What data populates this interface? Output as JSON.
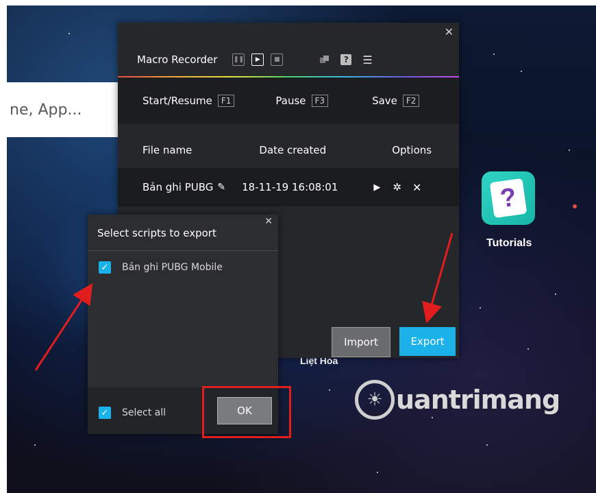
{
  "background": {
    "search_placeholder": "ne, App...",
    "desktop_label": "Liệt Hỏa",
    "tutorials_label": "Tutorials",
    "tutorials_icon": "question-mark-icon",
    "watermark": "uantrimang"
  },
  "macro_recorder": {
    "title": "Macro Recorder",
    "controls": [
      "pause-icon",
      "play-icon",
      "stop-icon"
    ],
    "tools": [
      "windows-icon",
      "help-icon",
      "list-icon"
    ],
    "hotkeys": [
      {
        "label": "Start/Resume",
        "key": "F1"
      },
      {
        "label": "Pause",
        "key": "F3"
      },
      {
        "label": "Save",
        "key": "F2"
      }
    ],
    "columns": {
      "file_name": "File name",
      "date_created": "Date created",
      "options": "Options"
    },
    "rows": [
      {
        "file_name": "Bản ghi PUBG",
        "date_created": "18-11-19 16:08:01"
      }
    ],
    "import_label": "Import",
    "export_label": "Export"
  },
  "export_dialog": {
    "title": "Select scripts to export",
    "items": [
      {
        "label": "Bản ghi PUBG Mobile",
        "checked": true
      }
    ],
    "select_all_label": "Select all",
    "select_all_checked": true,
    "ok_label": "OK"
  },
  "colors": {
    "accent": "#1ab2e8",
    "panel_bg": "#26272b",
    "highlight": "#e21d1d"
  }
}
